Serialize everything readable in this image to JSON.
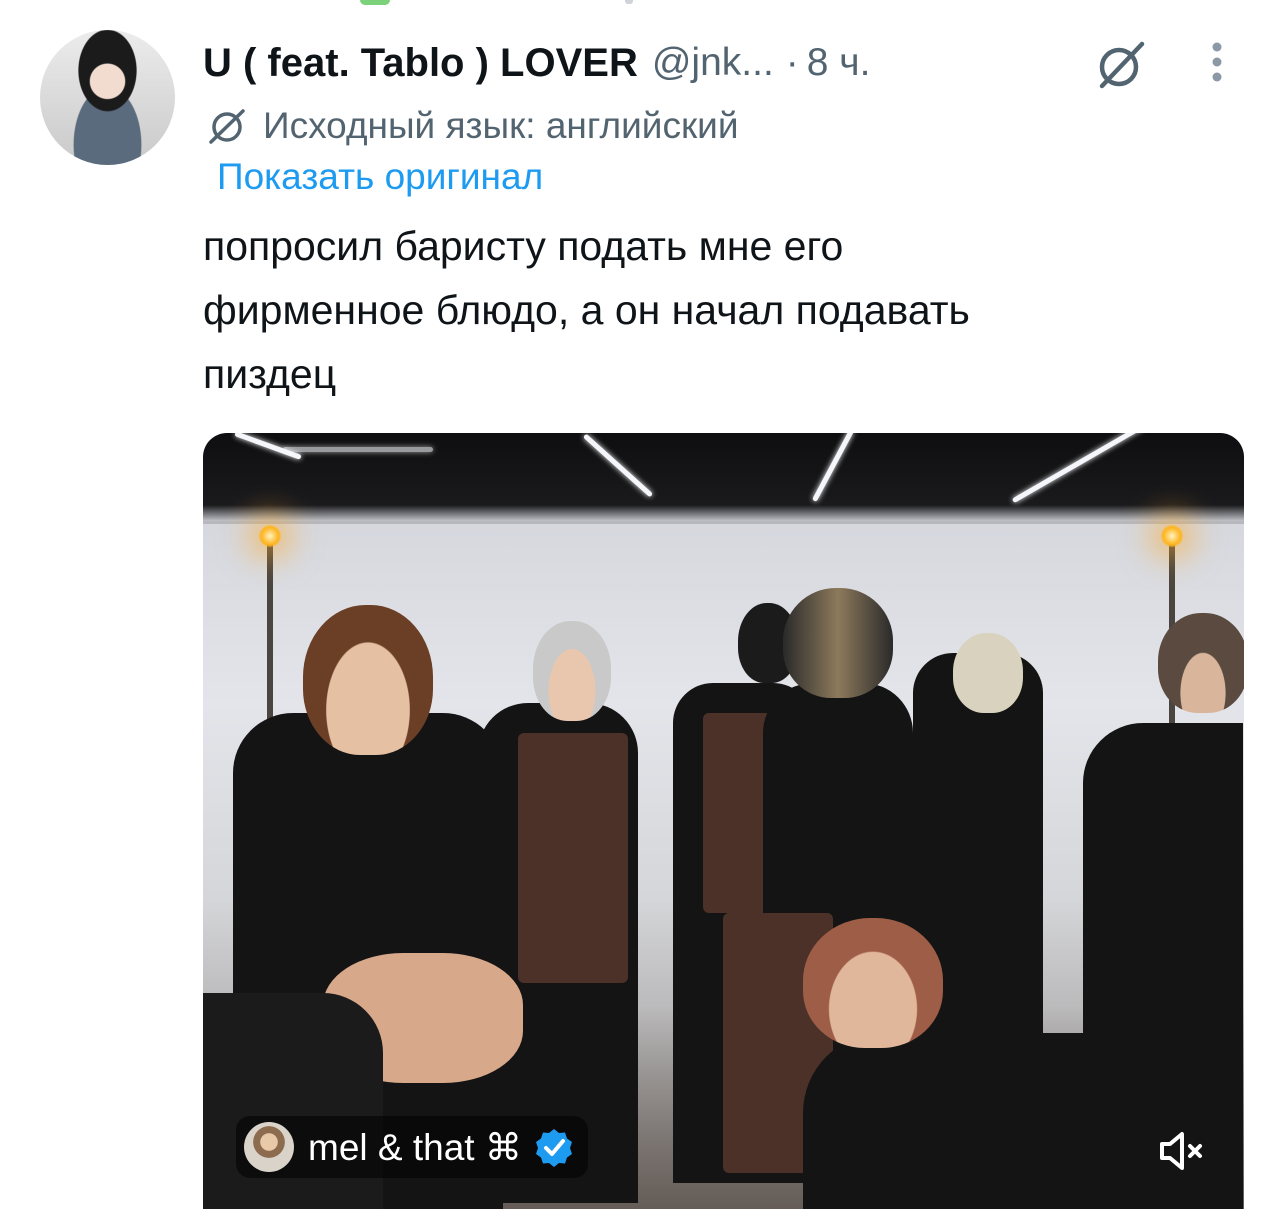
{
  "tweet": {
    "display_name": "U ( feat. Tablo ) LOVER",
    "handle": "@jnk...",
    "separator": "·",
    "time": "8 ч.",
    "source_language": "Исходный язык: английский",
    "show_original": "Показать оригинал",
    "text_lines": [
      "попросил баристу подать мне его",
      "фирменное блюдо, а он начал подавать",
      "пиздец"
    ]
  },
  "media": {
    "attribution_name": "mel & that ⌘",
    "verified": true,
    "muted": true
  },
  "icons": {
    "translate": "translate-icon",
    "more": "more-options-icon",
    "mute": "volume-muted-icon",
    "verified": "verified-badge-icon"
  },
  "colors": {
    "text": "#0f1419",
    "secondary": "#536471",
    "link": "#1d9bf0",
    "background": "#ffffff"
  }
}
